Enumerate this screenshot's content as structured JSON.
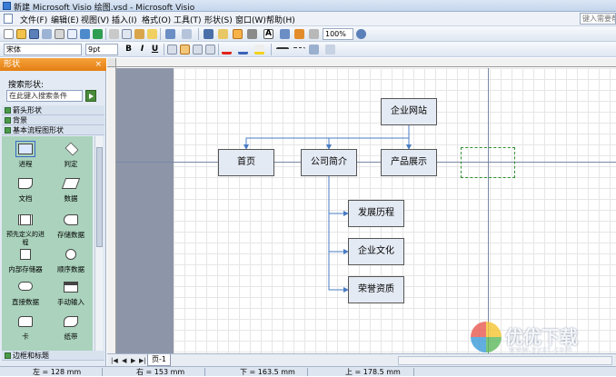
{
  "window": {
    "title": "新建 Microsoft Visio 绘图.vsd - Microsoft Visio"
  },
  "menu": {
    "items": [
      "文件(F)",
      "编辑(E)",
      "视图(V)",
      "插入(I)",
      "格式(O)",
      "工具(T)",
      "形状(S)",
      "窗口(W)",
      "帮助(H)"
    ],
    "help_placeholder": "键入需要帮助"
  },
  "toolbar": {
    "zoom": "100%",
    "font": "宋体",
    "font_size": "9pt",
    "bold": "B",
    "italic": "I",
    "underline": "U"
  },
  "shapes_panel": {
    "title": "形状",
    "close": "×",
    "search_label": "搜索形状:",
    "search_placeholder": "在此键入搜索条件",
    "stencils": [
      "箭头形状",
      "背景",
      "基本流程图形状"
    ],
    "bottom_stencil": "边框和标题",
    "shapes": [
      "进程",
      "判定",
      "文档",
      "数据",
      "预先定义的进程",
      "存储数据",
      "内部存储器",
      "顺序数据",
      "直接数据",
      "手动输入",
      "卡",
      "纸带"
    ]
  },
  "diagram": {
    "root": "企业网站",
    "level1": [
      "首页",
      "公司简介",
      "产品展示"
    ],
    "level2": [
      "发展历程",
      "企业文化",
      "荣誉资质"
    ]
  },
  "page_tab": {
    "label": "页-1"
  },
  "status": {
    "left": "左 = 128 mm",
    "right": "右 = 153 mm",
    "bottom": "下 = 163.5 mm",
    "top": "上 = 178.5 mm"
  },
  "watermark": {
    "text": "优优下载",
    "url": "www.yyxt.com"
  },
  "colors": {
    "panel_header": "#f08f25",
    "shape_fill": "#e4eaf3",
    "connector": "#4a7dc4",
    "shape_area": "#aad2bc"
  }
}
